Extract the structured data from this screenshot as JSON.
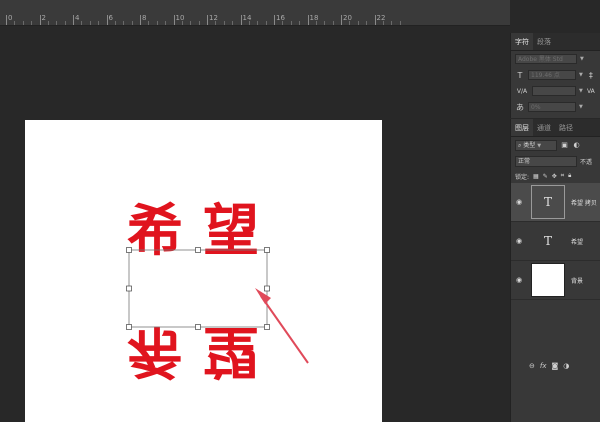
{
  "ruler": {
    "numbers": [
      "0",
      "2",
      "4",
      "6",
      "8",
      "10",
      "12",
      "14",
      "16",
      "18",
      "20",
      "22"
    ]
  },
  "artwork": {
    "glyph_1": "希",
    "glyph_2": "望",
    "glyph_3": "希",
    "glyph_4": "望",
    "text_color": "#e0141e",
    "arrow_color": "#e04a5a"
  },
  "character_panel": {
    "tabs": [
      {
        "label": "字符"
      },
      {
        "label": "段落"
      }
    ],
    "font_family": "Adobe 黑体 Std",
    "font_size": "119.46 点",
    "tracking_label": "V/A",
    "kerning_label": "VA",
    "scale": "0%",
    "size_icon": "T",
    "scale_icon": "あ"
  },
  "layers_panel": {
    "tabs": [
      {
        "label": "图层"
      },
      {
        "label": "通道"
      },
      {
        "label": "路径"
      }
    ],
    "filter_label": "类型",
    "blend_mode": "正常",
    "opacity_label": "不透",
    "lock_label": "锁定:",
    "layers": [
      {
        "name": "希望 拷贝",
        "thumb": "T"
      },
      {
        "name": "希望",
        "thumb": "T"
      },
      {
        "name": "背景",
        "thumb": ""
      }
    ],
    "footer_icons": [
      "link-icon",
      "fx-icon",
      "mask-icon",
      "adjustment-icon"
    ],
    "fx_label": "fx"
  }
}
